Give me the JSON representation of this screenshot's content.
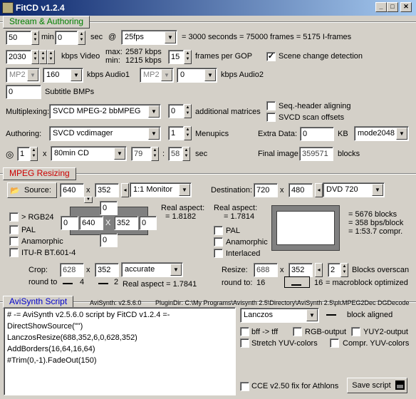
{
  "window": {
    "title": "FitCD v1.2.4",
    "min": "_",
    "max": "□",
    "close": "✕"
  },
  "tabs": {
    "stream": "Stream & Authoring",
    "mpeg": "MPEG Resizing",
    "avisynth": "AviSynth Script"
  },
  "stream": {
    "min_val": "50",
    "min_label": "min",
    "sec_val": "0",
    "sec_label": "sec",
    "at": "@",
    "fps": "25fps",
    "summary": "= 3000 seconds = 75000 frames = 5175 I-frames",
    "kbps_video_val": "2030",
    "kbps_video_label": "kbps Video",
    "max_label": "max:",
    "max_val": "2587 kbps",
    "min2_label": "min:",
    "min2_val": "1215 kbps",
    "gop_val": "15",
    "gop_label": "frames per GOP",
    "scene_label": "Scene change detection",
    "audio1_fmt": "MP2",
    "audio1_val": "160",
    "audio1_label": "kbps Audio1",
    "audio2_fmt": "MP2",
    "audio2_val": "0",
    "audio2_label": "kbps Audio2",
    "subtitle_val": "0",
    "subtitle_label": "Subtitle BMPs",
    "mux_label": "Multiplexing:",
    "mux_val": "SVCD MPEG-2 bbMPEG",
    "matrices_val": "0",
    "matrices_label": "additional matrices",
    "seq_label": "Seq.-header aligning",
    "svcd_scan_label": "SVCD scan offsets",
    "auth_label": "Authoring:",
    "auth_val": "SVCD vcdimager",
    "menupics_val": "1",
    "menupics_label": "Menupics",
    "extra_label": "Extra Data:",
    "extra_val": "0",
    "kb_label": "KB",
    "mode_val": "mode2048",
    "cd_count": "1",
    "x": "x",
    "cd_type": "80min CD",
    "cd_min": "79",
    "colon": ":",
    "cd_sec": "58",
    "sec2_label": "sec",
    "final_label": "Final image:",
    "final_val": "359571",
    "blocks_label": "blocks"
  },
  "mpeg": {
    "source_btn": "Source:",
    "src_w": "640",
    "src_h": "352",
    "src_ar": "1:1 Monitor",
    "dest_label": "Destination:",
    "dst_w": "720",
    "dst_h": "480",
    "dst_fmt": "DVD 720",
    "rgb24": "> RGB24",
    "pal": "PAL",
    "anamorphic": "Anamorphic",
    "itur": "ITU-R BT.601-4",
    "crop_top": "0",
    "crop_left": "0",
    "crop_w": "640",
    "crop_x": "X",
    "crop_h": "352",
    "crop_right": "0",
    "crop_bottom": "0",
    "real_aspect_label": "Real aspect:",
    "real_aspect_val": "= 1.8182",
    "real_aspect2_label": "Real aspect:",
    "real_aspect2_val": "= 1.7814",
    "pal2": "PAL",
    "anamorphic2": "Anamorphic",
    "interlaced": "Interlaced",
    "blocks1": "= 5676 blocks",
    "blocks2": "= 358 bps/block",
    "blocks3": "= 1:53.7 compr.",
    "crop_label": "Crop:",
    "cropv_w": "628",
    "cropv_h": "352",
    "crop_mode": "accurate",
    "round_label": "round to",
    "round1": "4",
    "round2": "2",
    "real_aspect3": "Real aspect = 1.7841",
    "resize_label": "Resize:",
    "res_w": "688",
    "res_h": "352",
    "overscan_val": "2",
    "overscan_label": "Blocks overscan",
    "round3_label": "round to:",
    "round3_val": "16",
    "round4_val": "16",
    "macroblock": "= macroblock optimized"
  },
  "avs": {
    "version": "AviSynth: v2.5.6.0",
    "plugindir": "PluginDir: C:\\My Programs\\Avisynth 2.5\\Directory\\AviSynth 2.5\\plugins",
    "mpeg2dec": "MPEG2Dec",
    "dgdecode": "DGDecode",
    "lines": [
      "# -= AviSynth v2.5.6.0 script by FitCD v1.2.4 =-",
      "DirectShowSource(\"\")",
      "LanczosResize(688,352,6,0,628,352)",
      "AddBorders(16,64,16,64)",
      "#Trim(0,-1).FadeOut(150)"
    ],
    "resizer": "Lanczos",
    "block_aligned": "block aligned",
    "bff": "bff -> tff",
    "rgb_out": "RGB-output",
    "yuy2_out": "YUY2-output",
    "stretch_yuv": "Stretch YUV-colors",
    "compr_yuv": "Compr. YUV-colors",
    "cce_fix": "CCE v2.50 fix for Athlons",
    "save_script": "Save script"
  }
}
